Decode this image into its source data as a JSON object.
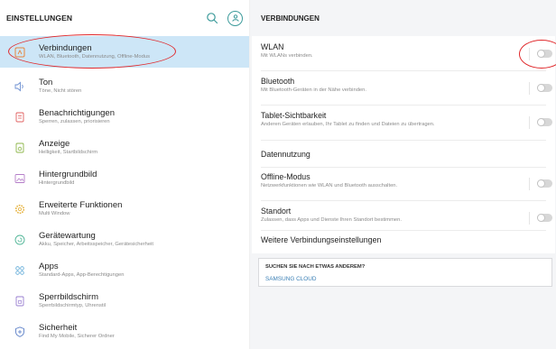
{
  "left": {
    "title": "EINSTELLUNGEN",
    "items": [
      {
        "title": "Verbindungen",
        "subtitle": "WLAN, Bluetooth, Datennutzung, Offline-Modus",
        "icon": "connections-icon"
      },
      {
        "title": "Ton",
        "subtitle": "Töne, Nicht stören",
        "icon": "speaker-icon"
      },
      {
        "title": "Benachrichtigungen",
        "subtitle": "Sperren, zulassen, priorisieren",
        "icon": "notifications-icon"
      },
      {
        "title": "Anzeige",
        "subtitle": "Helligkeit, Startbildschirm",
        "icon": "display-icon"
      },
      {
        "title": "Hintergrundbild",
        "subtitle": "Hintergrundbild",
        "icon": "wallpaper-icon"
      },
      {
        "title": "Erweiterte Funktionen",
        "subtitle": "Multi Window",
        "icon": "gear-icon"
      },
      {
        "title": "Gerätewartung",
        "subtitle": "Akku, Speicher, Arbeitsspeicher, Gerätesicherheit",
        "icon": "maintenance-icon"
      },
      {
        "title": "Apps",
        "subtitle": "Standard-Apps, App-Berechtigungen",
        "icon": "apps-icon"
      },
      {
        "title": "Sperrbildschirm",
        "subtitle": "Sperrbildschirmtyp, Uhrenstil",
        "icon": "lock-icon"
      },
      {
        "title": "Sicherheit",
        "subtitle": "Find My Mobile, Sicherer Ordner",
        "icon": "shield-icon"
      }
    ]
  },
  "right": {
    "title": "VERBINDUNGEN",
    "rows": [
      {
        "title": "WLAN",
        "subtitle": "Mit WLANs verbinden.",
        "toggle": "off"
      },
      {
        "title": "Bluetooth",
        "subtitle": "Mit Bluetooth-Geräten in der Nähe verbinden.",
        "toggle": "off"
      },
      {
        "title": "Tablet-Sichtbarkeit",
        "subtitle": "Anderen Geräten erlauben, Ihr Tablet zu finden und Dateien zu übertragen.",
        "toggle": "off"
      },
      {
        "title": "Datennutzung",
        "subtitle": ""
      },
      {
        "title": "Offline-Modus",
        "subtitle": "Netzwerkfunktionen wie WLAN und Bluetooth ausschalten.",
        "toggle": "off"
      },
      {
        "title": "Standort",
        "subtitle": "Zulassen, dass Apps und Dienste Ihren Standort bestimmen.",
        "toggle": "off"
      },
      {
        "title": "Weitere Verbindungseinstellungen",
        "subtitle": ""
      }
    ],
    "suggestion": {
      "heading": "SUCHEN SIE NACH ETWAS ANDEREM?",
      "link": "SAMSUNG CLOUD"
    }
  },
  "colors": {
    "selected_bg": "#cde6f7",
    "icon_teal": "#3d9b9b",
    "icon_orange": "#e6873e",
    "annotation_red": "#e0282b",
    "link_blue": "#3a7fb5"
  }
}
